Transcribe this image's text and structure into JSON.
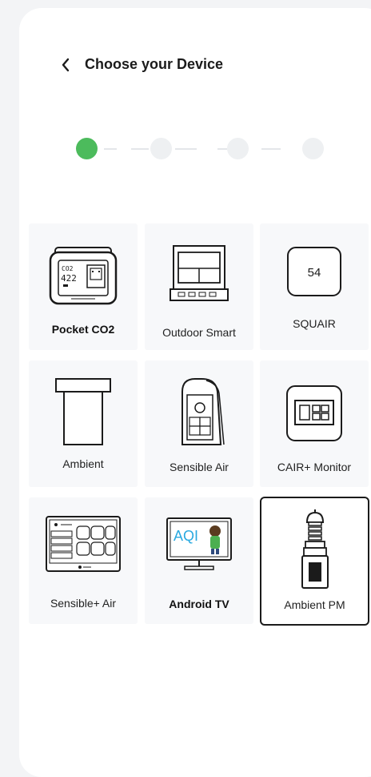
{
  "header": {
    "title": "Choose your Device",
    "back_icon": "chevron-left-icon"
  },
  "stepper": {
    "total_steps": 4,
    "current_step": 1,
    "active_color": "#4cbb5c",
    "inactive_color": "#eef0f2"
  },
  "devices": [
    {
      "label": "Pocket CO2",
      "display_value": "422",
      "screen_caption": "CO2",
      "bold": true
    },
    {
      "label": "Outdoor Smart",
      "bold": false
    },
    {
      "label": "SQUAIR",
      "display_value": "54",
      "bold": false
    },
    {
      "label": "Ambient",
      "bold": false
    },
    {
      "label": "Sensible Air",
      "bold": false
    },
    {
      "label": "CAIR+ Monitor",
      "bold": false
    },
    {
      "label": "Sensible+ Air",
      "bold": false
    },
    {
      "label": "Android TV",
      "screen_text": "AQI",
      "bold": true
    },
    {
      "label": "Ambient PM",
      "bold": false,
      "selected": true
    }
  ]
}
